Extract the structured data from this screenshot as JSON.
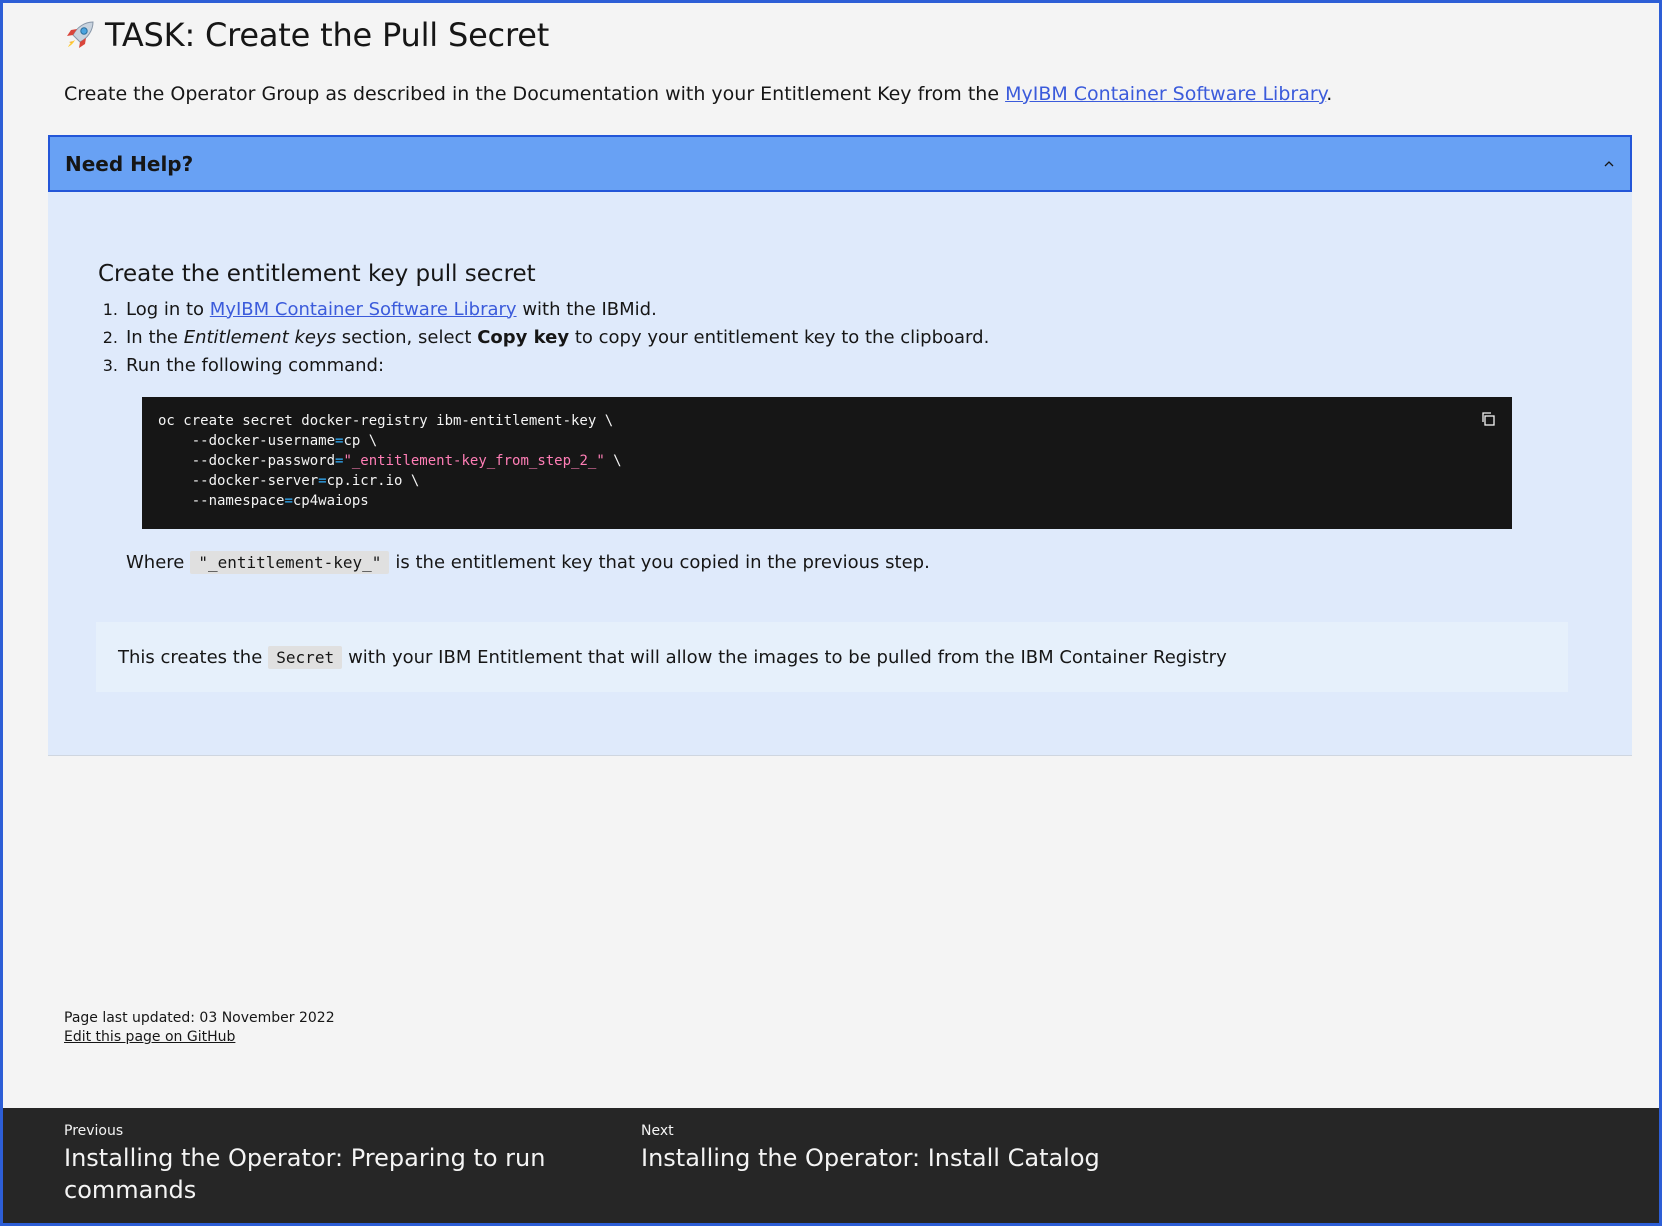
{
  "page": {
    "title": "TASK: Create the Pull Secret",
    "title_icon": "rocket-icon",
    "intro_prefix": "Create the Operator Group as described in the Documentation with your Entitlement Key from the ",
    "intro_link": "MyIBM Container Software Library",
    "intro_suffix": "."
  },
  "help": {
    "title": "Need Help?",
    "toggle_icon": "chevron-up-icon",
    "expanded": true,
    "heading": "Create the entitlement key pull secret",
    "steps": [
      {
        "num": "1.",
        "pre": "Log in to ",
        "link": "MyIBM Container Software Library",
        "post": " with the IBMid."
      },
      {
        "num": "2.",
        "pre": "In the ",
        "em": "Entitlement keys",
        "mid": " section, select ",
        "strong": "Copy key",
        "post": " to copy your entitlement key to the clipboard."
      },
      {
        "num": "3.",
        "text": "Run the following command:"
      }
    ],
    "code": {
      "line1": "oc create secret docker-registry ibm-entitlement-key \\",
      "line2_flag": "    --docker-username",
      "line2_eq": "=",
      "line2_val": "cp \\",
      "line3_flag": "    --docker-password",
      "line3_eq": "=",
      "line3_str": "\"_entitlement-key_from_step_2_\"",
      "line3_tail": " \\",
      "line4_flag": "    --docker-server",
      "line4_eq": "=",
      "line4_val": "cp.icr.io \\",
      "line5_flag": "    --namespace",
      "line5_eq": "=",
      "line5_val": "cp4waiops",
      "copy_icon": "copy-icon"
    },
    "where_pre": "Where",
    "where_code": "\"_entitlement-key_\"",
    "where_post": "is the entitlement key that you copied in the previous step.",
    "note_pre": "This creates the",
    "note_code": "Secret",
    "note_post": "with your IBM Entitlement that will allow the images to be pulled from the IBM Container Registry"
  },
  "meta": {
    "updated": "Page last updated: 03 November 2022",
    "edit_link": "Edit this page on GitHub"
  },
  "footer": {
    "prev_label": "Previous",
    "prev_title": "Installing the Operator: Preparing to run commands",
    "next_label": "Next",
    "next_title": "Installing the Operator: Install Catalog"
  }
}
